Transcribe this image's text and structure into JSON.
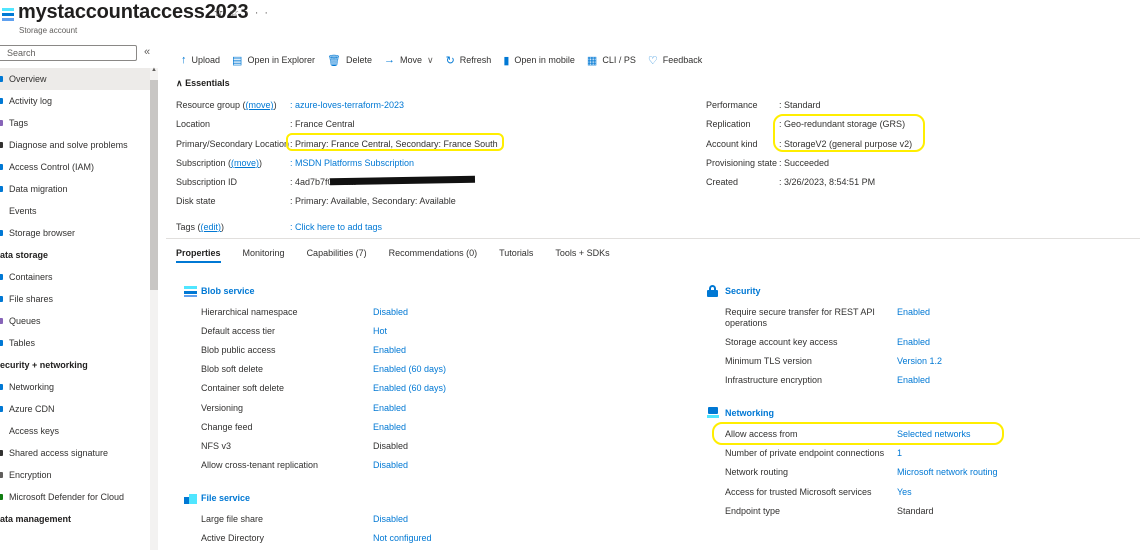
{
  "header": {
    "title": "mystaccountaccess2023",
    "subtitle": "Storage account",
    "pin_glyph": "✫",
    "star_glyph": "☆",
    "more_glyph": "···"
  },
  "colors": {
    "accent": "#0078d4",
    "highlight": "#ffee00",
    "text": "#323130"
  },
  "search": {
    "placeholder": "Search",
    "icon": "search-icon"
  },
  "sidebar": {
    "collapse_glyph": "«",
    "items": [
      {
        "label": "Overview",
        "selected": true,
        "icon_color": "#0078d4"
      },
      {
        "label": "Activity log",
        "icon_color": "#0078d4"
      },
      {
        "label": "Tags",
        "icon_color": "#8764b8"
      },
      {
        "label": "Diagnose and solve problems",
        "icon_color": "#323130"
      },
      {
        "label": "Access Control (IAM)",
        "icon_color": "#0078d4"
      },
      {
        "label": "Data migration",
        "icon_color": "#0078d4"
      },
      {
        "label": "Events",
        "icon_color": "#ffffff"
      },
      {
        "label": "Storage browser",
        "icon_color": "#0078d4"
      }
    ],
    "groups": [
      {
        "label": "ata storage",
        "items": [
          {
            "label": "Containers",
            "icon_color": "#0078d4"
          },
          {
            "label": "File shares",
            "icon_color": "#0078d4"
          },
          {
            "label": "Queues",
            "icon_color": "#8764b8"
          },
          {
            "label": "Tables",
            "icon_color": "#0078d4"
          }
        ]
      },
      {
        "label": "ecurity + networking",
        "items": [
          {
            "label": "Networking",
            "icon_color": "#0078d4"
          },
          {
            "label": "Azure CDN",
            "icon_color": "#0078d4"
          },
          {
            "label": "Access keys",
            "icon_color": "#ffffff"
          },
          {
            "label": "Shared access signature",
            "icon_color": "#323130"
          },
          {
            "label": "Encryption",
            "icon_color": "#605e5c"
          },
          {
            "label": "Microsoft Defender for Cloud",
            "icon_color": "#107c10"
          }
        ]
      },
      {
        "label": "ata management",
        "items": []
      }
    ]
  },
  "toolbar": [
    {
      "label": "Upload",
      "glyph": "↑"
    },
    {
      "label": "Open in Explorer",
      "glyph": "▤"
    },
    {
      "label": "Delete",
      "glyph": "🗑"
    },
    {
      "label": "Move",
      "glyph": "→",
      "dropdown": "∨"
    },
    {
      "label": "Refresh",
      "glyph": "↻"
    },
    {
      "label": "Open in mobile",
      "glyph": "▮"
    },
    {
      "label": "CLI / PS",
      "glyph": "▦"
    },
    {
      "label": "Feedback",
      "glyph": "♡"
    }
  ],
  "essentials": {
    "toggle_label": "Essentials",
    "toggle_glyph": "∧",
    "left": [
      {
        "label": "Resource group",
        "link": "(move)",
        "value": ": azure-loves-terraform-2023",
        "value_link": true
      },
      {
        "label": "Location",
        "value": ": France Central"
      },
      {
        "label": "Primary/Secondary Location",
        "value": ": Primary: France Central, Secondary: France South"
      },
      {
        "label": "Subscription",
        "link": "(move)",
        "value": ": MSDN Platforms Subscription",
        "value_link": true
      },
      {
        "label": "Subscription ID",
        "value": ": 4ad7b7f0-83aa"
      },
      {
        "label": "Disk state",
        "value": ": Primary: Available, Secondary: Available"
      },
      {
        "label": "Tags",
        "link": "(edit)",
        "value": ": Click here to add tags",
        "value_link": true
      }
    ],
    "right": [
      {
        "label": "Performance",
        "value": ": Standard"
      },
      {
        "label": "Replication",
        "value": ": Geo-redundant storage (GRS)"
      },
      {
        "label": "Account kind",
        "value": ": StorageV2 (general purpose v2)"
      },
      {
        "label": "Provisioning state",
        "value": ": Succeeded"
      },
      {
        "label": "Created",
        "value": ": 3/26/2023, 8:54:51 PM"
      }
    ]
  },
  "tabs": [
    {
      "label": "Properties",
      "active": true
    },
    {
      "label": "Monitoring"
    },
    {
      "label": "Capabilities (7)"
    },
    {
      "label": "Recommendations (0)"
    },
    {
      "label": "Tutorials"
    },
    {
      "label": "Tools + SDKs"
    }
  ],
  "blob_service": {
    "title": "Blob service",
    "rows": [
      {
        "label": "Hierarchical namespace",
        "value": "Disabled",
        "link": true
      },
      {
        "label": "Default access tier",
        "value": "Hot",
        "link": true
      },
      {
        "label": "Blob public access",
        "value": "Enabled",
        "link": true
      },
      {
        "label": "Blob soft delete",
        "value": "Enabled (60 days)",
        "link": true
      },
      {
        "label": "Container soft delete",
        "value": "Enabled (60 days)",
        "link": true
      },
      {
        "label": "Versioning",
        "value": "Enabled",
        "link": true
      },
      {
        "label": "Change feed",
        "value": "Enabled",
        "link": true
      },
      {
        "label": "NFS v3",
        "value": "Disabled",
        "link": false
      },
      {
        "label": "Allow cross-tenant replication",
        "value": "Disabled",
        "link": true
      }
    ]
  },
  "file_service": {
    "title": "File service",
    "rows": [
      {
        "label": "Large file share",
        "value": "Disabled",
        "link": true
      },
      {
        "label": "Active Directory",
        "value": "Not configured",
        "link": true
      }
    ]
  },
  "security": {
    "title": "Security",
    "rows": [
      {
        "label": "Require secure transfer for REST API operations",
        "value": "Enabled",
        "link": true
      },
      {
        "label": "Storage account key access",
        "value": "Enabled",
        "link": true
      },
      {
        "label": "Minimum TLS version",
        "value": "Version 1.2",
        "link": true
      },
      {
        "label": "Infrastructure encryption",
        "value": "Enabled",
        "link": true
      }
    ]
  },
  "networking": {
    "title": "Networking",
    "rows": [
      {
        "label": "Allow access from",
        "value": "Selected networks",
        "link": true
      },
      {
        "label": "Number of private endpoint connections",
        "value": "1",
        "link": true
      },
      {
        "label": "Network routing",
        "value": "Microsoft network routing",
        "link": true
      },
      {
        "label": "Access for trusted Microsoft services",
        "value": "Yes",
        "link": true
      },
      {
        "label": "Endpoint type",
        "value": "Standard",
        "link": false
      }
    ]
  }
}
